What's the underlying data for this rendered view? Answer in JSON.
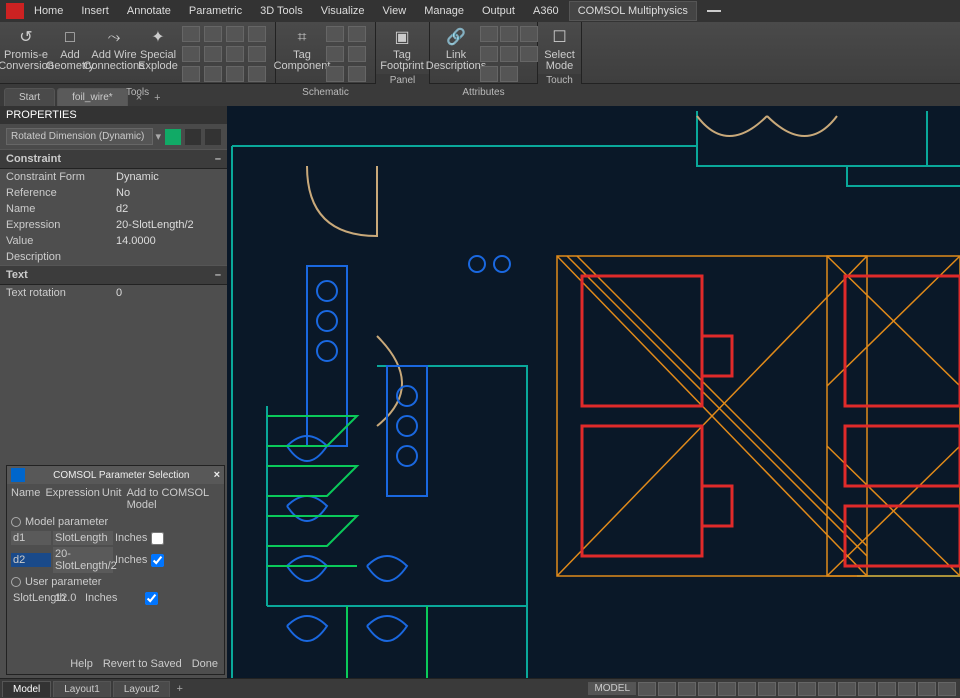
{
  "menubar": [
    "Home",
    "Insert",
    "Annotate",
    "Parametric",
    "3D Tools",
    "Visualize",
    "View",
    "Manage",
    "Output",
    "A360",
    "COMSOL Multiphysics"
  ],
  "menubar_active": 10,
  "ribbon": {
    "groups": [
      {
        "label": "Tools",
        "big": [
          {
            "name": "promise-conversion",
            "label": "Promis-e Conversion",
            "glyph": "↺"
          },
          {
            "name": "add-geometry",
            "label": "Add Geometry",
            "glyph": "□"
          },
          {
            "name": "add-wire-connections",
            "label": "Add Wire Connections",
            "glyph": "⤳"
          },
          {
            "name": "special-explode",
            "label": "Special Explode",
            "glyph": "✦"
          }
        ],
        "small": 12
      },
      {
        "label": "Schematic",
        "big": [
          {
            "name": "tag-component",
            "label": "Tag Component",
            "glyph": "⌗"
          }
        ],
        "small": 6
      },
      {
        "label": "Panel",
        "big": [
          {
            "name": "tag-footprint",
            "label": "Tag Footprint",
            "glyph": "▣"
          }
        ]
      },
      {
        "label": "Attributes",
        "big": [
          {
            "name": "link-descriptions",
            "label": "Link Descriptions",
            "glyph": "🔗"
          }
        ],
        "small": 8
      },
      {
        "label": "Touch",
        "big": [
          {
            "name": "select-mode",
            "label": "Select Mode",
            "glyph": "☐"
          }
        ]
      }
    ]
  },
  "doc_tabs": [
    {
      "label": "Start"
    },
    {
      "label": "foil_wire*",
      "active": true
    }
  ],
  "properties": {
    "title": "PROPERTIES",
    "selector": "Rotated Dimension (Dynamic)",
    "sections": [
      {
        "name": "Constraint",
        "rows": [
          {
            "k": "Constraint Form",
            "v": "Dynamic"
          },
          {
            "k": "Reference",
            "v": "No"
          },
          {
            "k": "Name",
            "v": "d2"
          },
          {
            "k": "Expression",
            "v": "20-SlotLength/2"
          },
          {
            "k": "Value",
            "v": "14.0000"
          },
          {
            "k": "Description",
            "v": ""
          }
        ]
      },
      {
        "name": "Text",
        "rows": [
          {
            "k": "Text rotation",
            "v": "0"
          }
        ]
      }
    ]
  },
  "param_dialog": {
    "title": "COMSOL Parameter Selection",
    "headers": [
      "Name",
      "Expression",
      "Unit",
      "Add to COMSOL Model"
    ],
    "group1": "Model parameter",
    "group2": "User parameter",
    "rows1": [
      {
        "name": "d1",
        "expr": "SlotLength",
        "unit": "Inches",
        "checked": false
      },
      {
        "name": "d2",
        "expr": "20-SlotLength/2",
        "unit": "Inches",
        "checked": true,
        "selected": true
      }
    ],
    "rows2": [
      {
        "name": "SlotLength",
        "expr": "12.0",
        "unit": "Inches",
        "checked": true
      }
    ],
    "buttons": [
      "Help",
      "Revert to Saved",
      "Done"
    ]
  },
  "bottom_tabs": [
    "Model",
    "Layout1",
    "Layout2"
  ],
  "bottom_active": 0,
  "status": {
    "model": "MODEL"
  }
}
